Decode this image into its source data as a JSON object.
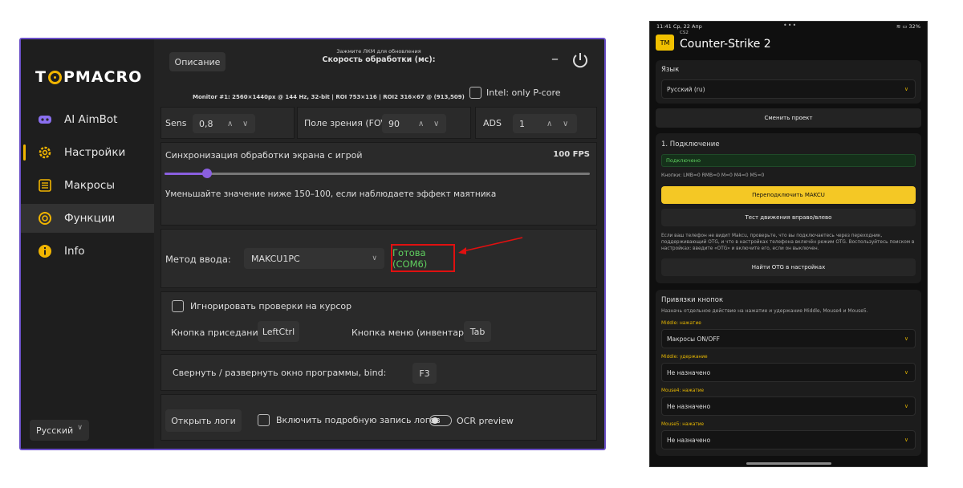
{
  "desktop": {
    "logo": {
      "left": "T",
      "right": "PMACRO"
    },
    "sidebar": {
      "items": [
        {
          "label": "AI AimBot",
          "icon": "gamepad-icon"
        },
        {
          "label": "Настройки",
          "icon": "gear-icon"
        },
        {
          "label": "Макросы",
          "icon": "list-icon"
        },
        {
          "label": "Функции",
          "icon": "target-icon"
        },
        {
          "label": "Info",
          "icon": "info-icon"
        }
      ],
      "language": "Русский"
    },
    "header": {
      "description_button": "Описание",
      "hint_small": "Зажмите ЛКМ для обновления",
      "hint_title": "Скорость обработки (мс):",
      "minimize": "–"
    },
    "monitor_info": "Monitor #1: 2560×1440px @ 144 Hz, 32-bit | ROI 753×116 | ROI2 316×67 @ (913,509)",
    "intel_label": "Intel: only P-core",
    "spinners": {
      "sens_label": "Sens",
      "sens_value": "0,8",
      "fov_label": "Поле зрения (FOV)",
      "fov_value": "90",
      "ads_label": "ADS",
      "ads_value": "1"
    },
    "sync": {
      "label": "Синхронизация обработки экрана с игрой",
      "fps": "100 FPS",
      "slider_fraction": 0.1,
      "hint": "Уменьшайте значение ниже 150–100, если наблюдаете эффект маятника"
    },
    "input_method": {
      "label": "Метод ввода:",
      "value": "MAKCU1PC",
      "status": "Готова (COM6)"
    },
    "cursor": {
      "ignore_label": "Игнорировать проверки на курсор",
      "crouch_label": "Кнопка приседания:",
      "crouch_value": "LeftCtrl",
      "menu_label": "Кнопка меню (инвентарь):",
      "menu_value": "Tab"
    },
    "minimize_bind": {
      "label": "Свернуть / развернуть окно программы, bind:",
      "value": "F3"
    },
    "logs": {
      "open_button": "Открыть логи",
      "verbose_label": "Включить подробную запись логов",
      "ocr_label": "OCR preview"
    }
  },
  "phone": {
    "status": {
      "time": "11:41",
      "date": "Ср, 22 Апр",
      "dots": "•••",
      "battery": "≋ ▭ 32%"
    },
    "app_tag": "CS2",
    "logo": "TM",
    "title": "Counter-Strike 2",
    "language_label": "Язык",
    "language_value": "Русский (ru)",
    "change_project": "Сменить проект",
    "connection": {
      "title": "1. Подключение",
      "status": "Подключено",
      "buttons_info": "Кнопки: LMB=0 RMB=0 M=0 M4=0 M5=0",
      "reconnect": "Переподключить MAKCU",
      "test_move": "Тест движения вправо/влево",
      "otg_hint": "Если ваш телефон не видит Makcu, проверьте, что вы подключаетесь через переходник, поддерживающий OTG, и что в настройках телефона включён режим OTG. Воспользуйтесь поиском в настройках: введите «OTG» и включите его, если он выключен.",
      "find_otg": "Найти OTG в настройках"
    },
    "bindings": {
      "title": "Привязки кнопок",
      "subtitle": "Назначь отдельное действие на нажатие и удержание Middle, Mouse4 и Mouse5.",
      "rows": [
        {
          "label": "Middle: нажатие",
          "value": "Макросы ON/OFF"
        },
        {
          "label": "Middle: удержание",
          "value": "Не назначено"
        },
        {
          "label": "Mouse4: нажатие",
          "value": "Не назначено"
        },
        {
          "label": "Mouse5: нажатие",
          "value": "Не назначено"
        }
      ]
    }
  },
  "colors": {
    "accent_purple": "#8a5fe0",
    "brand_yellow": "#f4c825",
    "status_green": "#5fcf5f",
    "highlight_red": "#e01010"
  }
}
